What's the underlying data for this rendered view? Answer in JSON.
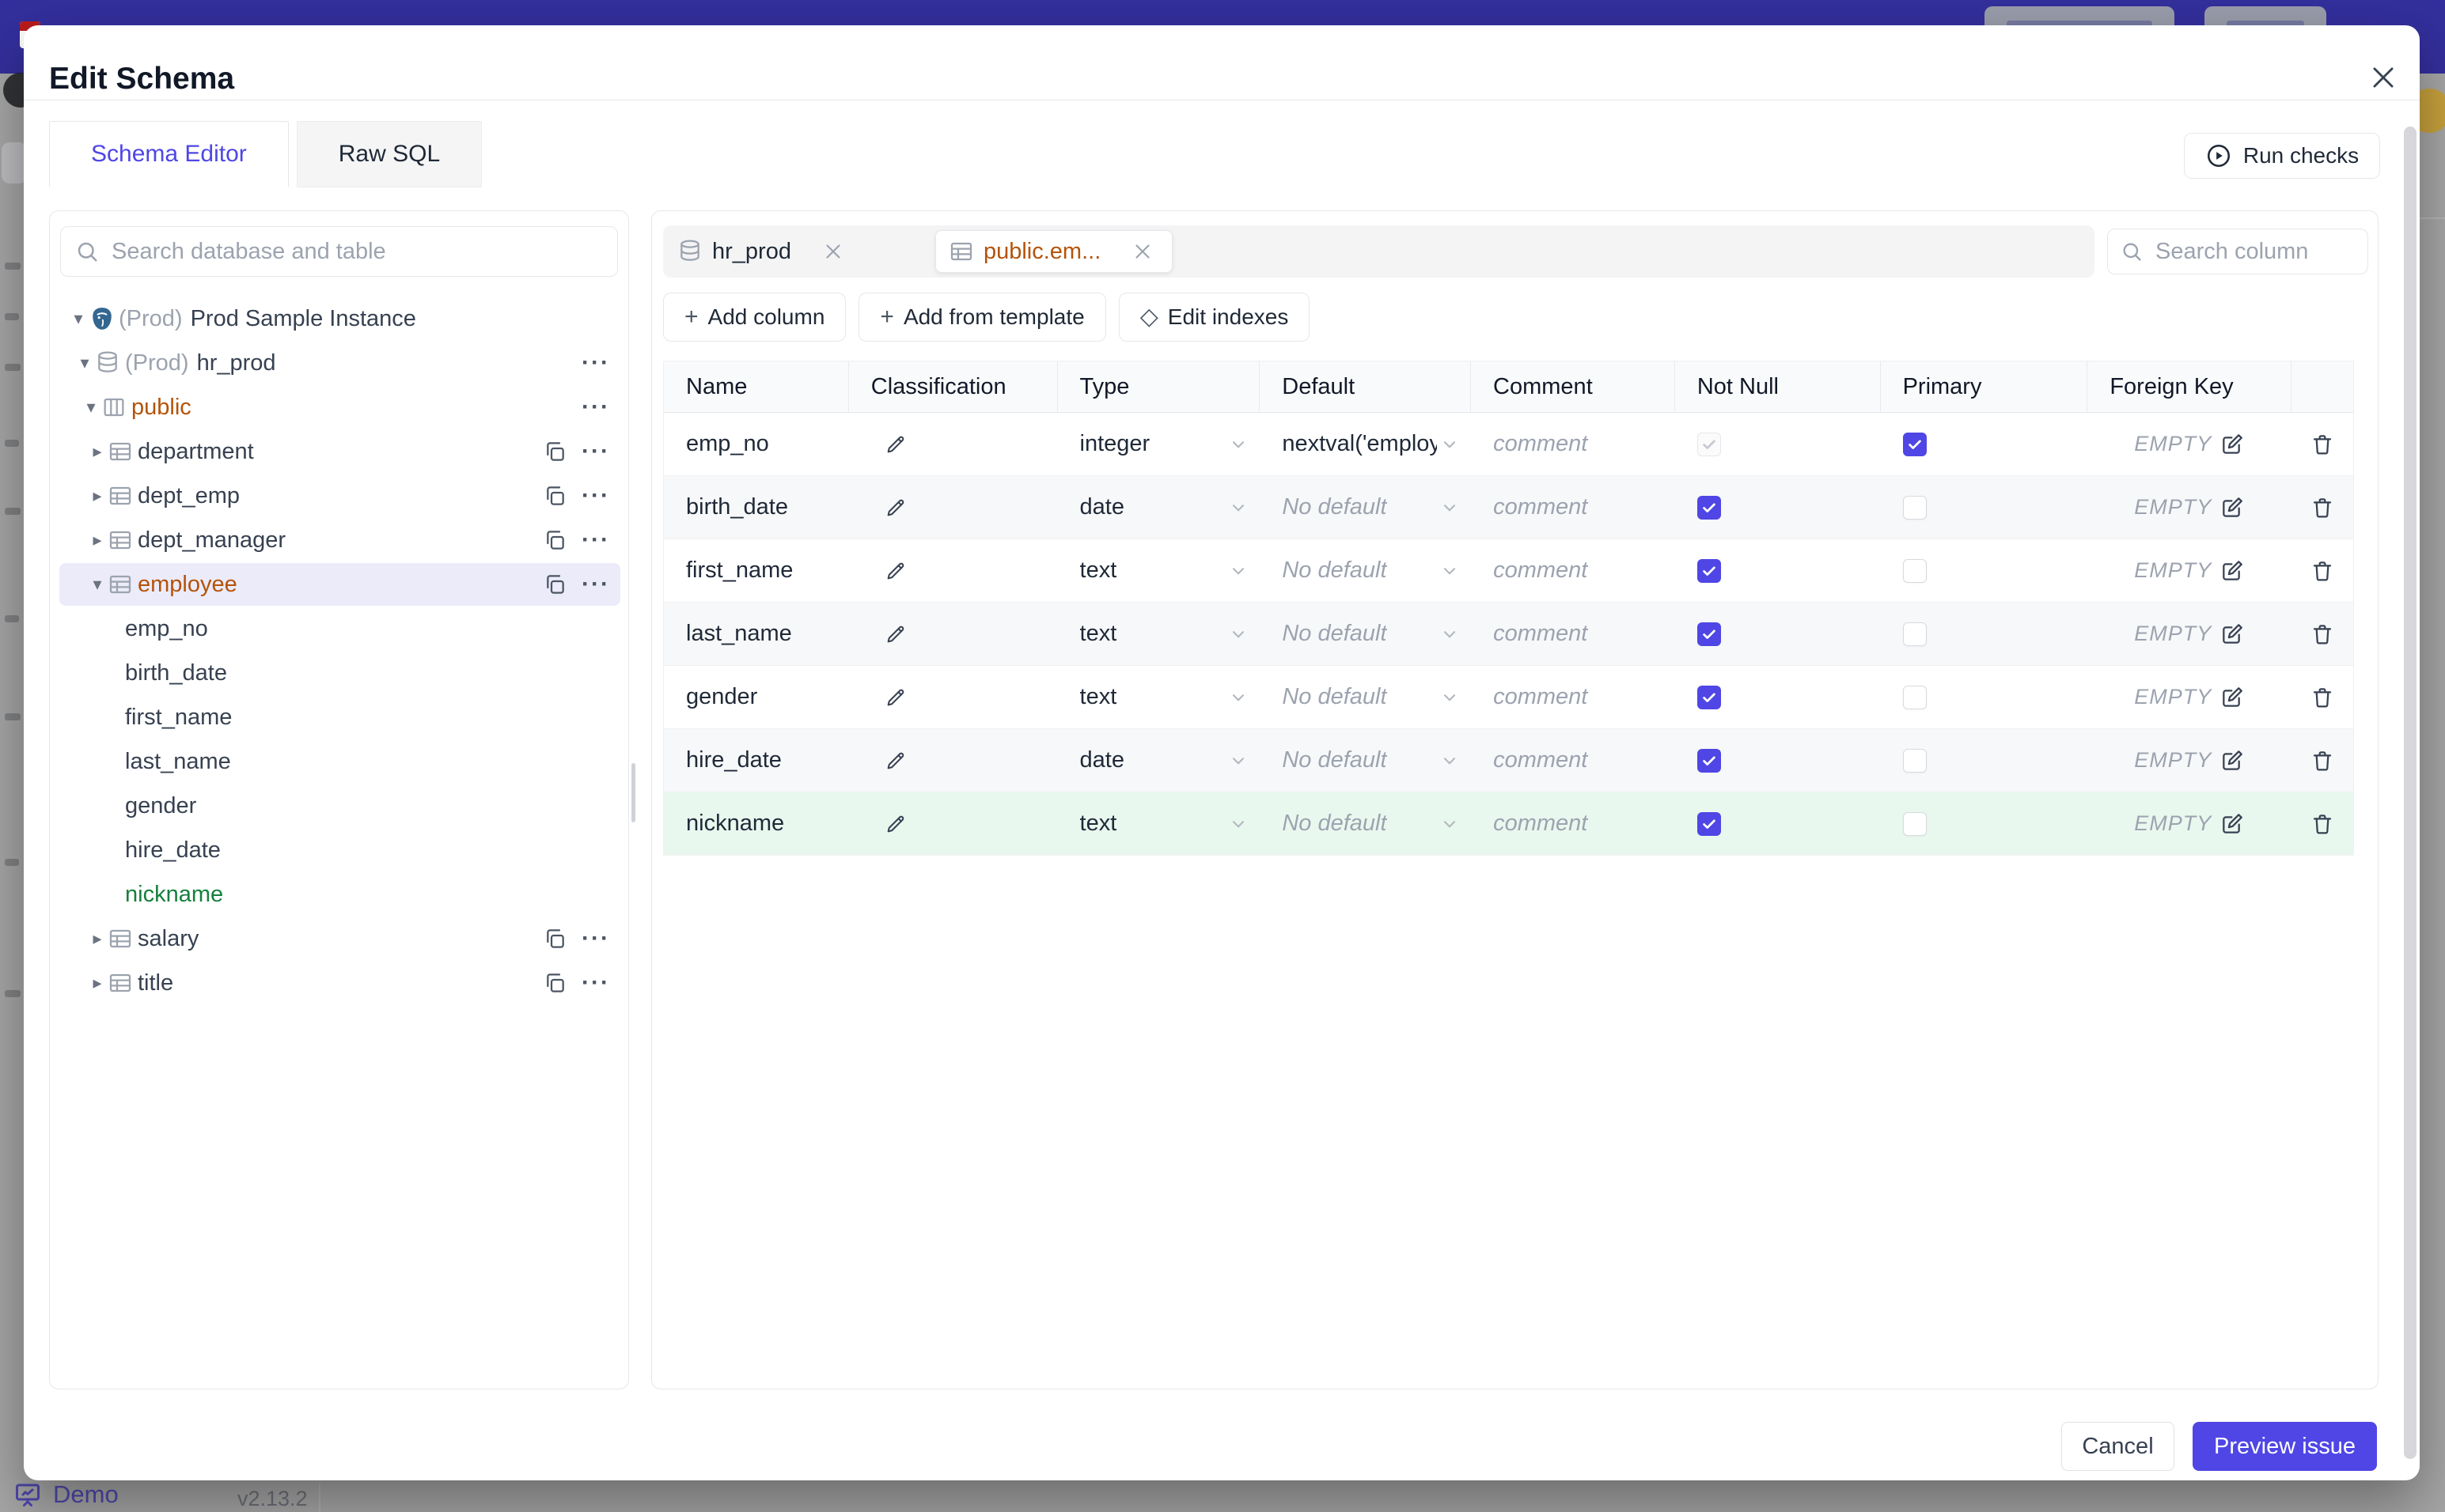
{
  "backdrop": {
    "demo_label": "Demo",
    "version": "v2.13.2",
    "logo_number": "1"
  },
  "colors": {
    "accent": "#4f46e5",
    "topbar": "#332f9c",
    "amber_text": "#b45309",
    "green_text": "#15803d",
    "green_row_bg": "#e9f8ef",
    "selected_tree_bg": "#ecebfa"
  },
  "modal": {
    "title": "Edit Schema",
    "tabs": [
      {
        "label": "Schema Editor",
        "active": true
      },
      {
        "label": "Raw SQL",
        "active": false
      }
    ],
    "run_checks": {
      "icon": "play-circle-icon",
      "label": "Run checks"
    },
    "sidebar": {
      "search_placeholder": "Search database and table",
      "tree": [
        {
          "level": 0,
          "expander": "down",
          "icon": "postgres-icon",
          "prefix": "(Prod)",
          "label": "Prod Sample Instance",
          "color": "default",
          "trailing": [],
          "selected": false
        },
        {
          "level": 1,
          "expander": "down",
          "icon": "database-icon",
          "prefix": "(Prod)",
          "label": "hr_prod",
          "color": "default",
          "trailing": [
            "more"
          ],
          "selected": false
        },
        {
          "level": 2,
          "expander": "down",
          "icon": "schema-icon",
          "prefix": "",
          "label": "public",
          "color": "amber",
          "trailing": [
            "more"
          ],
          "selected": false
        },
        {
          "level": 3,
          "expander": "right",
          "icon": "table-icon",
          "prefix": "",
          "label": "department",
          "color": "default",
          "trailing": [
            "copy",
            "more"
          ],
          "selected": false
        },
        {
          "level": 3,
          "expander": "right",
          "icon": "table-icon",
          "prefix": "",
          "label": "dept_emp",
          "color": "default",
          "trailing": [
            "copy",
            "more"
          ],
          "selected": false
        },
        {
          "level": 3,
          "expander": "right",
          "icon": "table-icon",
          "prefix": "",
          "label": "dept_manager",
          "color": "default",
          "trailing": [
            "copy",
            "more"
          ],
          "selected": false
        },
        {
          "level": 3,
          "expander": "down",
          "icon": "table-icon",
          "prefix": "",
          "label": "employee",
          "color": "amber",
          "trailing": [
            "copy",
            "more"
          ],
          "selected": true
        },
        {
          "level": 4,
          "expander": null,
          "icon": null,
          "prefix": "",
          "label": "emp_no",
          "color": "default",
          "trailing": [],
          "selected": false
        },
        {
          "level": 4,
          "expander": null,
          "icon": null,
          "prefix": "",
          "label": "birth_date",
          "color": "default",
          "trailing": [],
          "selected": false
        },
        {
          "level": 4,
          "expander": null,
          "icon": null,
          "prefix": "",
          "label": "first_name",
          "color": "default",
          "trailing": [],
          "selected": false
        },
        {
          "level": 4,
          "expander": null,
          "icon": null,
          "prefix": "",
          "label": "last_name",
          "color": "default",
          "trailing": [],
          "selected": false
        },
        {
          "level": 4,
          "expander": null,
          "icon": null,
          "prefix": "",
          "label": "gender",
          "color": "default",
          "trailing": [],
          "selected": false
        },
        {
          "level": 4,
          "expander": null,
          "icon": null,
          "prefix": "",
          "label": "hire_date",
          "color": "default",
          "trailing": [],
          "selected": false
        },
        {
          "level": 4,
          "expander": null,
          "icon": null,
          "prefix": "",
          "label": "nickname",
          "color": "green",
          "trailing": [],
          "selected": false
        },
        {
          "level": 3,
          "expander": "right",
          "icon": "table-icon",
          "prefix": "",
          "label": "salary",
          "color": "default",
          "trailing": [
            "copy",
            "more"
          ],
          "selected": false
        },
        {
          "level": 3,
          "expander": "right",
          "icon": "table-icon",
          "prefix": "",
          "label": "title",
          "color": "default",
          "trailing": [
            "copy",
            "more"
          ],
          "selected": false
        }
      ]
    },
    "editor": {
      "chips": [
        {
          "icon": "database-icon",
          "label": "hr_prod",
          "active": false
        },
        {
          "icon": "table-icon",
          "label": "public.em...",
          "active": true
        }
      ],
      "column_search_placeholder": "Search column",
      "toolbar": [
        {
          "icon": "plus-icon",
          "label": "Add column"
        },
        {
          "icon": "plus-icon",
          "label": "Add from template"
        },
        {
          "icon": "diamond-icon",
          "label": "Edit indexes"
        }
      ],
      "table": {
        "headers": [
          "Name",
          "Classification",
          "Type",
          "Default",
          "Comment",
          "Not Null",
          "Primary",
          "Foreign Key",
          ""
        ],
        "rows": [
          {
            "name": "emp_no",
            "type": "integer",
            "default": "nextval('employ",
            "default_muted": false,
            "comment_placeholder": "comment",
            "not_null": true,
            "not_null_disabled": true,
            "primary": true,
            "foreign_key": "EMPTY",
            "highlight": ""
          },
          {
            "name": "birth_date",
            "type": "date",
            "default": "No default",
            "default_muted": true,
            "comment_placeholder": "comment",
            "not_null": true,
            "not_null_disabled": false,
            "primary": false,
            "foreign_key": "EMPTY",
            "highlight": "alt"
          },
          {
            "name": "first_name",
            "type": "text",
            "default": "No default",
            "default_muted": true,
            "comment_placeholder": "comment",
            "not_null": true,
            "not_null_disabled": false,
            "primary": false,
            "foreign_key": "EMPTY",
            "highlight": ""
          },
          {
            "name": "last_name",
            "type": "text",
            "default": "No default",
            "default_muted": true,
            "comment_placeholder": "comment",
            "not_null": true,
            "not_null_disabled": false,
            "primary": false,
            "foreign_key": "EMPTY",
            "highlight": "alt"
          },
          {
            "name": "gender",
            "type": "text",
            "default": "No default",
            "default_muted": true,
            "comment_placeholder": "comment",
            "not_null": true,
            "not_null_disabled": false,
            "primary": false,
            "foreign_key": "EMPTY",
            "highlight": ""
          },
          {
            "name": "hire_date",
            "type": "date",
            "default": "No default",
            "default_muted": true,
            "comment_placeholder": "comment",
            "not_null": true,
            "not_null_disabled": false,
            "primary": false,
            "foreign_key": "EMPTY",
            "highlight": "alt"
          },
          {
            "name": "nickname",
            "type": "text",
            "default": "No default",
            "default_muted": true,
            "comment_placeholder": "comment",
            "not_null": true,
            "not_null_disabled": false,
            "primary": false,
            "foreign_key": "EMPTY",
            "highlight": "green"
          }
        ]
      }
    },
    "footer": {
      "cancel_label": "Cancel",
      "submit_label": "Preview issue"
    }
  }
}
